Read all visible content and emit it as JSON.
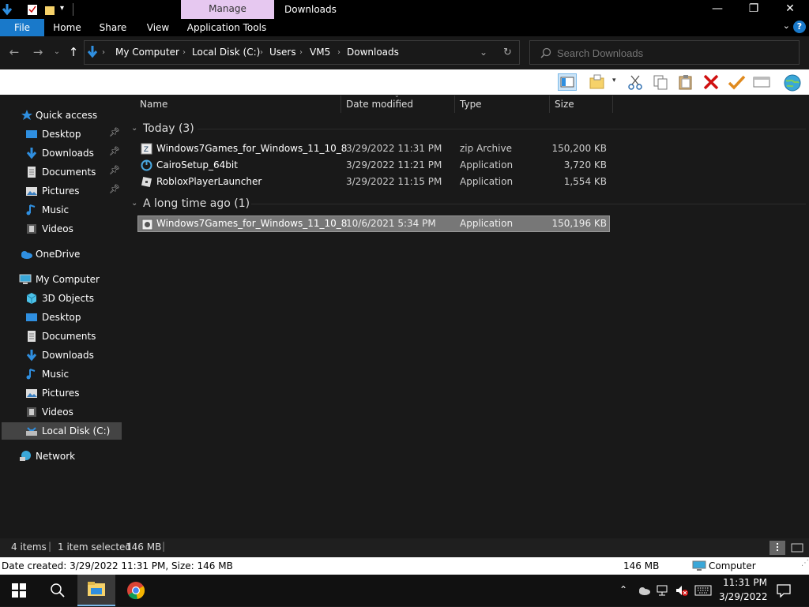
{
  "window": {
    "title": "Downloads",
    "contextual_tab": "Manage",
    "controls": {
      "minimize": "—",
      "maximize": "❐",
      "close": "✕"
    }
  },
  "ribbon": {
    "tabs": [
      "File",
      "Home",
      "Share",
      "View",
      "Application Tools"
    ],
    "file_color": "#1979ca",
    "manage_color": "#e6c8f0"
  },
  "address": {
    "breadcrumbs": [
      "My Computer",
      "Local Disk (C:)",
      "Users",
      "VM5",
      "Downloads"
    ]
  },
  "search": {
    "placeholder": "Search Downloads"
  },
  "sidebar": {
    "quick_access": "Quick access",
    "quick_items": [
      {
        "label": "Desktop",
        "icon": "desktop-icon",
        "pinned": true
      },
      {
        "label": "Downloads",
        "icon": "downloads-icon",
        "pinned": true
      },
      {
        "label": "Documents",
        "icon": "documents-icon",
        "pinned": true
      },
      {
        "label": "Pictures",
        "icon": "pictures-icon",
        "pinned": true
      },
      {
        "label": "Music",
        "icon": "music-icon",
        "pinned": false
      },
      {
        "label": "Videos",
        "icon": "videos-icon",
        "pinned": false
      }
    ],
    "onedrive": "OneDrive",
    "computer": "My Computer",
    "computer_items": [
      {
        "label": "3D Objects",
        "icon": "3d-objects-icon"
      },
      {
        "label": "Desktop",
        "icon": "desktop-icon"
      },
      {
        "label": "Documents",
        "icon": "documents-icon"
      },
      {
        "label": "Downloads",
        "icon": "downloads-icon"
      },
      {
        "label": "Music",
        "icon": "music-icon"
      },
      {
        "label": "Pictures",
        "icon": "pictures-icon"
      },
      {
        "label": "Videos",
        "icon": "videos-icon"
      },
      {
        "label": "Local Disk (C:)",
        "icon": "drive-icon",
        "selected": true
      }
    ],
    "network": "Network"
  },
  "columns": {
    "name": "Name",
    "date": "Date modified",
    "type": "Type",
    "size": "Size"
  },
  "groups": [
    {
      "label": "Today (3)",
      "files": [
        {
          "name": "Windows7Games_for_Windows_11_10_8",
          "date": "3/29/2022 11:31 PM",
          "type": "zip Archive",
          "size": "150,200 KB",
          "icon": "zip-icon"
        },
        {
          "name": "CairoSetup_64bit",
          "date": "3/29/2022 11:21 PM",
          "type": "Application",
          "size": "3,720 KB",
          "icon": "cairo-setup-icon"
        },
        {
          "name": "RobloxPlayerLauncher",
          "date": "3/29/2022 11:15 PM",
          "type": "Application",
          "size": "1,554 KB",
          "icon": "roblox-icon"
        }
      ]
    },
    {
      "label": "A long time ago (1)",
      "files": [
        {
          "name": "Windows7Games_for_Windows_11_10_8",
          "date": "10/6/2021 5:34 PM",
          "type": "Application",
          "size": "150,196 KB",
          "icon": "installer-icon",
          "selected": true
        }
      ]
    }
  ],
  "status": {
    "count": "4 items",
    "selected": "1 item selected",
    "size": "146 MB"
  },
  "details": {
    "info": "Date created: 3/29/2022 11:31 PM, Size: 146 MB",
    "size": "146 MB",
    "location": "Computer"
  },
  "taskbar": {
    "time": "11:31 PM",
    "date": "3/29/2022"
  }
}
